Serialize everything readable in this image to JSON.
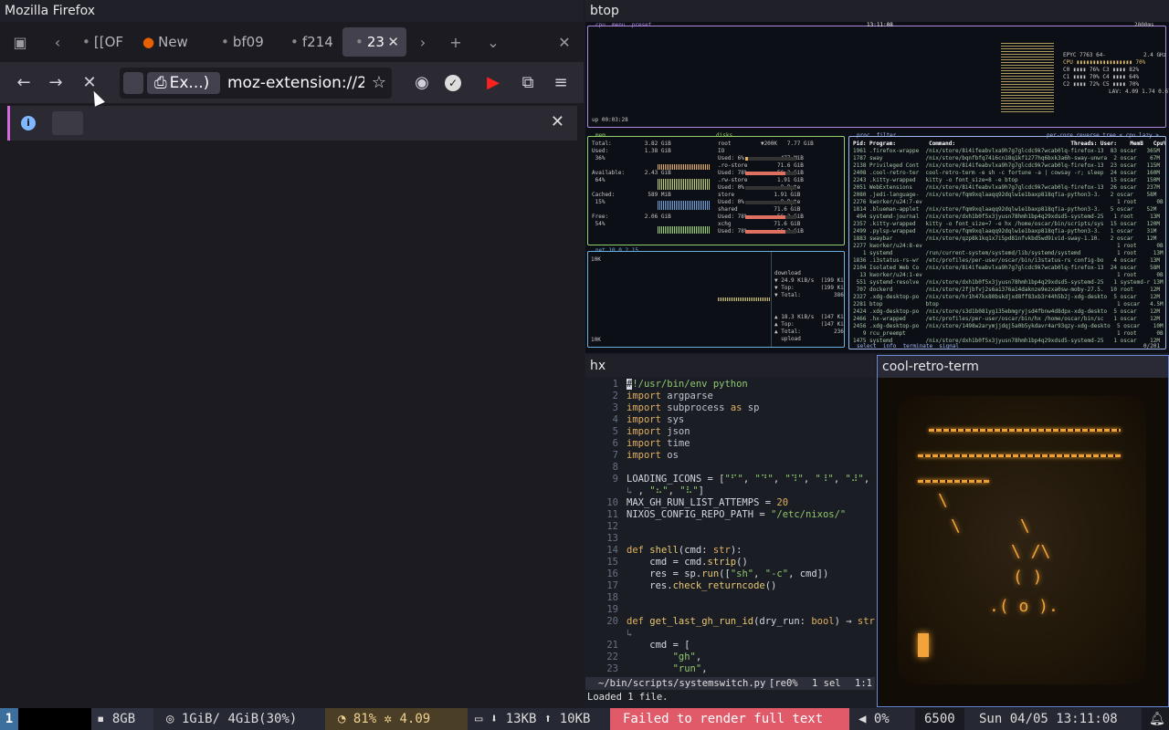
{
  "firefox": {
    "title": "Mozilla Firefox",
    "tabs": [
      {
        "label": "[[OF",
        "dot": "•"
      },
      {
        "label": "New",
        "dot": ""
      },
      {
        "label": "bf09",
        "dot": "•"
      },
      {
        "label": "f214",
        "dot": "•"
      },
      {
        "label": "23",
        "dot": "•"
      }
    ],
    "identity_label": "Ex...)",
    "url": "moz-extension://2"
  },
  "btop": {
    "title": "btop",
    "cpu_header": "cpu  menu  preset",
    "clock": "13:11:08",
    "refresh": "2000ms",
    "cpu_model": "EPYC 7763 64-",
    "freq": "2.4 GHz",
    "cpu_rows": [
      "CPU ▮▮▮▮▮▮▮▮▮▮▮▮▮▮▮▮▮ 70%",
      "C0 ▮▮▮▮ 76% C3 ▮▮▮▮ 82%",
      "C1 ▮▮▮▮ 70% C4 ▮▮▮▮ 64%",
      "C2 ▮▮▮▮ 72% C5 ▮▮▮▮ 70%"
    ],
    "lav": "LAV: 4.09 1.74 0.67",
    "uptime": "up 00:03:28",
    "mem_header": "mem",
    "mem_lines": [
      "Total:          3.82 GiB",
      "Used:           1.38 GiB",
      " 36%",
      "",
      "Available:      2.43 GiB",
      " 64%",
      "",
      "Cached:          589 MiB",
      " 15%",
      "",
      "Free:           2.06 GiB",
      " 54%"
    ],
    "disk_header": "disks",
    "disk_lines": [
      "root         ▼200K   7.77 GiB",
      "IO",
      "Used: 6%           477 MiB",
      ".ro-store         71.6 GiB",
      "Used: 78%         56.2 GiB",
      ".rw-store         1.91 GiB",
      "Used: 0%           0 Byte",
      "store            1.91 GiB",
      "Used: 0%           0 Byte",
      "shared           71.6 GiB",
      "Used: 78%         56.2 GiB",
      "xchg             71.6 GiB",
      "Used: 78%         56.2 GiB"
    ],
    "net_header": "net 10.0.2.15",
    "net_scale_top": "10K",
    "net_scale_bot": "10K",
    "net_lines": [
      "download",
      "▼ 24.9 KiB/s  (199 Kibps)",
      "▼ Top:        (199 Kibps)",
      "▼ Total:          386 KiB",
      "",
      "",
      "▲ 18.3 KiB/s  (147 Kibps)",
      "▲ Top:        (147 Kibps)",
      "▲ Total:          236 KiB",
      "  upload"
    ],
    "proc_header": "proc  filter",
    "proc_tail": "per-core reverse tree < cpu lazy >",
    "proc_columns": "Pid: Program:          Command:                                   Threads: User:    MemB   Cpu%",
    "processes": [
      "1961 .firefox-wrappe  /nix/store/8i4ifeabvlxa9h7g7glcdc9k7wcab0lq-firefox-13  83 oscar   365M  13.7",
      "1787 sway             /nix/store/bqnfbfq7416cn18q1kf1277hq6bxk3a6h-sway-unwra  2 oscar    67M   6.6",
      "2138 Privileged Cont  /nix/store/8i4ifeabvlxa9h7g7glcdc9k7wcab0lq-firefox-13  23 oscar   115M   8.4",
      "2408 .cool-retro-ter  cool-retro-term -e sh -c fortune -a | cowsay -r; sleep  24 oscar   160M   3.2",
      "2243 .kitty-wrapped   kitty -o font_size=8 -e btop                            15 oscar   150M   0.9",
      "2051 WebExtensions    /nix/store/8i4ifeabvlxa9h7g7glcdc9k7wcab0lq-firefox-13  26 oscar   237M   0.6",
      "2080 .jedi-language-  /nix/store/fqm9xqlaaqq92dqlw1e1baxp818qfia-python3-3.   2 oscar    58M   0.0",
      "2276 kworker/u24:7-ev                                                           1 root      0B   0.2",
      "1814 .blueman-applet  /nix/store/fqm9xqlaaqq92dqlw1e1baxp818qfia-python3-3.   5 oscar    52M   2.7",
      " 494 systemd-journal  /nix/store/dxh1b0f5x3jyusn78hmh1bp4q29xdsd5-systemd-25   1 root     13M   0.0",
      "2357 .kitty-wrapped   kitty -o font_size=7 -e hx /home/oscar/bin/scripts/sys  15 oscar   120M   0.0",
      "2499 .pylsp-wrapped   /nix/store/fqm9xqlaaqq92dqlw1e1baxp818qfia-python3-3.   1 oscar    31M   0.0",
      "1883 swaybar          /nix/store/qzp8k1kq1x7i5pd81nfvkbd5wd9ivid-sway-1.10.   2 oscar    12M   0.2",
      "2277 kworker/u24:8-ev                                                           1 root      0B   0.0",
      "   1 systemd          /run/current-system/systemd/lib/systemd/systemd           1 root     13M   0.0",
      "1836 .i3status-rs-wr  /etc/profiles/per-user/oscar/bin/i3status-rs config-bo   4 oscar    13M   0.0",
      "2104 Isolated Web Co  /nix/store/8i4ifeabvlxa9h7g7glcdc9k7wcab0lq-firefox-13  24 oscar    58M   0.0",
      "  13 kworker/u24:1-ev                                                           1 root      0B   0.0",
      " 551 systemd-resolve  /nix/store/dxh1b0f5x3jyusn78hmh1bp4q29xdsd5-systemd-25   1 systemd-r 13M   1.3",
      " 707 dockerd          /nix/store/2fjbfvj2s6a1376a14daknze9ezxa0sw-moby-27.5.  10 root     12M   0.0",
      "2327 .xdg-desktop-po  /nix/store/hr1h47kx80bskdjxd8ff83xb3r44h5b2j-xdg-deskto  5 oscar    12M   0.0",
      "2281 btop             btop                                                      1 oscar   4.5M   0.0",
      "2424 .xdg-desktop-po  /nix/store/s3d1b081yg135ebmgryjsd4fbnw4d8dpx-xdg-deskto  5 oscar    12M   0.0",
      "2466 .hx-wrapped      /etc/profiles/per-user/oscar/bin/hx /home/oscar/bin/sc   1 oscar    12M   0.0",
      "2456 .xdg-desktop-po  /nix/store/1498w2arymjjdqj5a0b5ykdavr4ar93qzy-xdg-deskto  5 oscar    10M   0.0",
      "   9 rcu_preempt                                                                1 root      0B   0.0",
      "1475 systemd          /nix/store/dxh1b0f5x3jyusn78hmh1bp4q29xdsd5-systemd-25   1 oscar    12M   0.0"
    ],
    "proc_footer": "select  info  terminate  signal",
    "proc_count": "0/201"
  },
  "hx": {
    "title": "hx",
    "status_path": "~/bin/scripts/systemswitch.py",
    "status_mode": "[re0%",
    "status_sel": "1 sel",
    "status_pos": "1:1",
    "message": "Loaded 1 file."
  },
  "crt": {
    "title": "cool-retro-term",
    "ascii_lines": [
      "\\",
      "\\      \\",
      "\\ /\\",
      "( )",
      ".( o ).",
      ""
    ]
  },
  "bar": {
    "workspace": "1",
    "disk": "8GB",
    "mem": "1GiB/ 4GiB(30%)",
    "cpu": "81%",
    "load": "4.09",
    "net_down": "13KB",
    "net_up": "10KB",
    "error": "Failed to render full text",
    "volume": "0%",
    "brightness": "6500",
    "datetime": "Sun 04/05 13:11:08"
  },
  "colors": {
    "cpu_box": "#b08ae0",
    "mem_box": "#8fd06a",
    "net_box": "#6ab0e0",
    "proc_box": "#a0b8f0",
    "crt_amber": "#f0a030",
    "bar_error": "#e05a6a",
    "bar_workspace": "#3c6f9c"
  }
}
